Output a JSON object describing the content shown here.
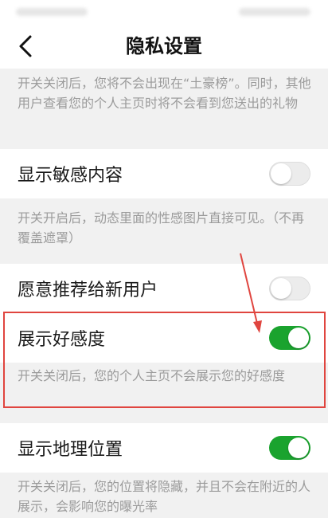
{
  "header": {
    "title": "隐私设置",
    "back_icon": "chevron-left-icon"
  },
  "rich_list": {
    "description": "开关关闭后，您将不会出现在“土豪榜”。同时，其他用户查看您的个人主页时将不会看到您送出的礼物"
  },
  "settings": [
    {
      "label": "显示敏感内容",
      "enabled": false,
      "description": "开关开启后，动态里面的性感图片直接可见。（不再覆盖遮罩）"
    },
    {
      "label": "愿意推荐给新用户",
      "enabled": false,
      "description": ""
    },
    {
      "label": "展示好感度",
      "enabled": true,
      "description": "开关关闭后，您的个人主页不会展示您的好感度"
    },
    {
      "label": "显示地理位置",
      "enabled": true,
      "description": "开关关闭后，您的位置将隐藏，并且不会在附近的人展示，会影响您的曝光率"
    }
  ],
  "colors": {
    "toggle_on": "#1aa32e",
    "toggle_off": "#ececec",
    "highlight": "#e0453f",
    "description_text": "#9b9b9b",
    "background": "#f1f1f1"
  }
}
